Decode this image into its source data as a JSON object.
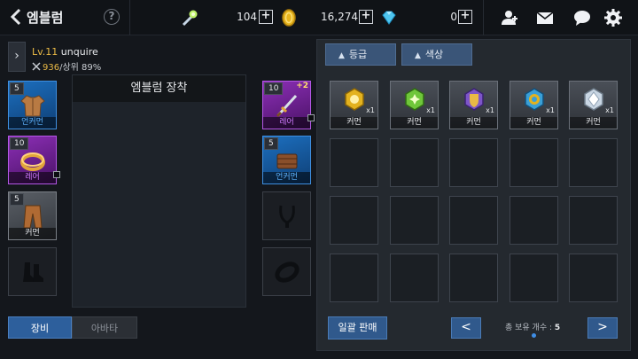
{
  "header": {
    "title": "엠블럼",
    "help_label": "?",
    "resources": [
      {
        "icon": "torch-icon",
        "value": "104"
      },
      {
        "icon": "gold-coin-icon",
        "value": "16,274"
      },
      {
        "icon": "diamond-icon",
        "value": "0"
      }
    ],
    "plus_label": "+",
    "actions": [
      "friends-icon",
      "mail-icon",
      "chat-icon",
      "settings-icon"
    ]
  },
  "character": {
    "level_prefix": "Lv.11",
    "name": "unquire",
    "power": "936",
    "rank_text": "/상위 89%"
  },
  "left_slots": [
    {
      "level": "5",
      "grade": "언커먼",
      "grade_color": "#5fb4ff",
      "item": "armor-icon"
    },
    {
      "level": "10",
      "grade": "레어",
      "grade_color": "#d07bff",
      "item": "ring-icon"
    },
    {
      "level": "5",
      "grade": "커먼",
      "grade_color": "#e6e8eb",
      "item": "pants-icon"
    },
    {
      "item": "boots-icon"
    }
  ],
  "right_slots": [
    {
      "level": "10",
      "enhance": "+2",
      "grade": "레어",
      "grade_color": "#d07bff",
      "item": "sword-icon"
    },
    {
      "level": "5",
      "grade": "언커먼",
      "grade_color": "#5fb4ff",
      "item": "belt-icon"
    },
    {
      "item": "necklace-icon"
    },
    {
      "item": "bracelet-icon"
    }
  ],
  "emblem_panel": {
    "title": "엠블럼 장착"
  },
  "tabs": {
    "equip": "장비",
    "avatar": "아바타"
  },
  "filters": {
    "grade": "등급",
    "color": "색상",
    "arrow": "▲"
  },
  "inventory": [
    {
      "name": "커먼",
      "count": "x1",
      "gem": "yellow-emblem-icon",
      "color": "#e3b21f"
    },
    {
      "name": "커먼",
      "count": "x1",
      "gem": "green-emblem-icon",
      "color": "#6fc63a"
    },
    {
      "name": "커먼",
      "count": "x1",
      "gem": "purple-emblem-icon",
      "color": "#7d55c8"
    },
    {
      "name": "커먼",
      "count": "x1",
      "gem": "blue-emblem-icon",
      "color": "#3a9fd6"
    },
    {
      "name": "커먼",
      "count": "x1",
      "gem": "white-emblem-icon",
      "color": "#c9d6e3"
    }
  ],
  "footer": {
    "sell_all": "일괄 판매",
    "prev": "<",
    "next": ">",
    "total_label": "총 보유 개수 :",
    "total_value": "5"
  }
}
